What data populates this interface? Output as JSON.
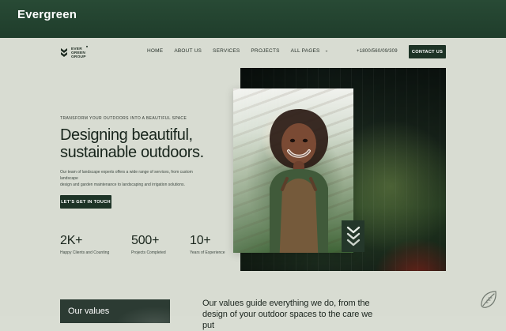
{
  "window": {
    "title": "Evergreen"
  },
  "header": {
    "brand": {
      "name_lines": [
        "EVER",
        "GREEN",
        "GROUP"
      ]
    },
    "nav": {
      "items": [
        {
          "label": "HOME"
        },
        {
          "label": "ABOUT US"
        },
        {
          "label": "SERVICES"
        },
        {
          "label": "PROJECTS"
        },
        {
          "label": "ALL PAGES",
          "has_dropdown": true
        }
      ],
      "dropdown_icon": "chevron-down-icon"
    },
    "phone": "+1800/560/09/309",
    "contact_button": "CONTACT US"
  },
  "hero": {
    "kicker": "TRANSFORM YOUR OUTDOORS INTO A BEAUTIFUL SPACE",
    "headline_lines": [
      "Designing beautiful,",
      "sustainable outdoors."
    ],
    "subtext_lines": [
      "Our team of landscape experts offers a wide range of services, from custom landscape",
      "design and garden maintenance to landscaping and irrigation solutions."
    ],
    "cta": "LET’S GET IN TOUCH",
    "stats": [
      {
        "value": "2K+",
        "label": "Happy Clients and Counting"
      },
      {
        "value": "500+",
        "label": "Projects Completed"
      },
      {
        "value": "10+",
        "label": "Years of Experience"
      }
    ],
    "badge_icon": "chevron-stack-icon"
  },
  "bottom": {
    "card_title": "Our values",
    "text_lines": [
      "Our values guide everything we do, from the",
      "design of your outdoor spaces to the care we put"
    ]
  },
  "icons": {
    "brand": "brand-mark-icon",
    "leaf": "leaf-icon"
  },
  "colors": {
    "primary_dark": "#1d3326",
    "page_bg": "#d8dcd2",
    "topbar_bg": "#284a35",
    "text_dark": "#18251c"
  }
}
